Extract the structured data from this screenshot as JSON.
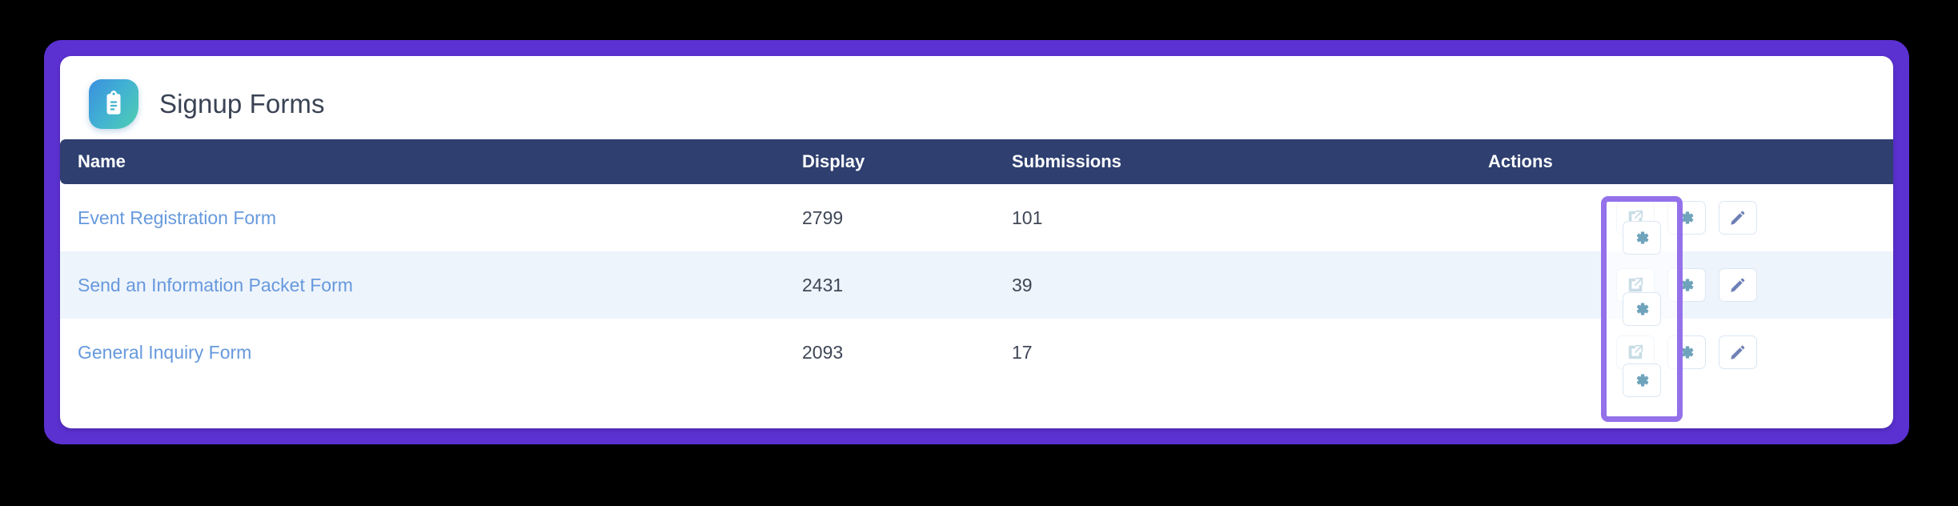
{
  "header": {
    "title": "Signup Forms",
    "icon": "clipboard-icon"
  },
  "table": {
    "columns": [
      {
        "key": "name",
        "label": "Name"
      },
      {
        "key": "display",
        "label": "Display"
      },
      {
        "key": "submissions",
        "label": "Submissions"
      },
      {
        "key": "actions",
        "label": "Actions"
      }
    ],
    "rows": [
      {
        "name": "Event Registration Form",
        "display": "2799",
        "submissions": "101"
      },
      {
        "name": "Send an Information Packet Form",
        "display": "2431",
        "submissions": "39"
      },
      {
        "name": "General Inquiry Form",
        "display": "2093",
        "submissions": "17"
      }
    ]
  },
  "actions": {
    "open": "external-link-icon",
    "settings": "gear-icon",
    "edit": "pencil-icon"
  },
  "highlight": {
    "target": "gear-icon-column"
  },
  "colors": {
    "frame_border": "#5b31d1",
    "table_header_bg": "#2e3f70",
    "row_alt_bg": "#eef4fc",
    "link": "#6699dd",
    "highlight_border": "#9471ea",
    "icon_teal": "#6fa3bc",
    "icon_slate": "#6e7fb5"
  }
}
